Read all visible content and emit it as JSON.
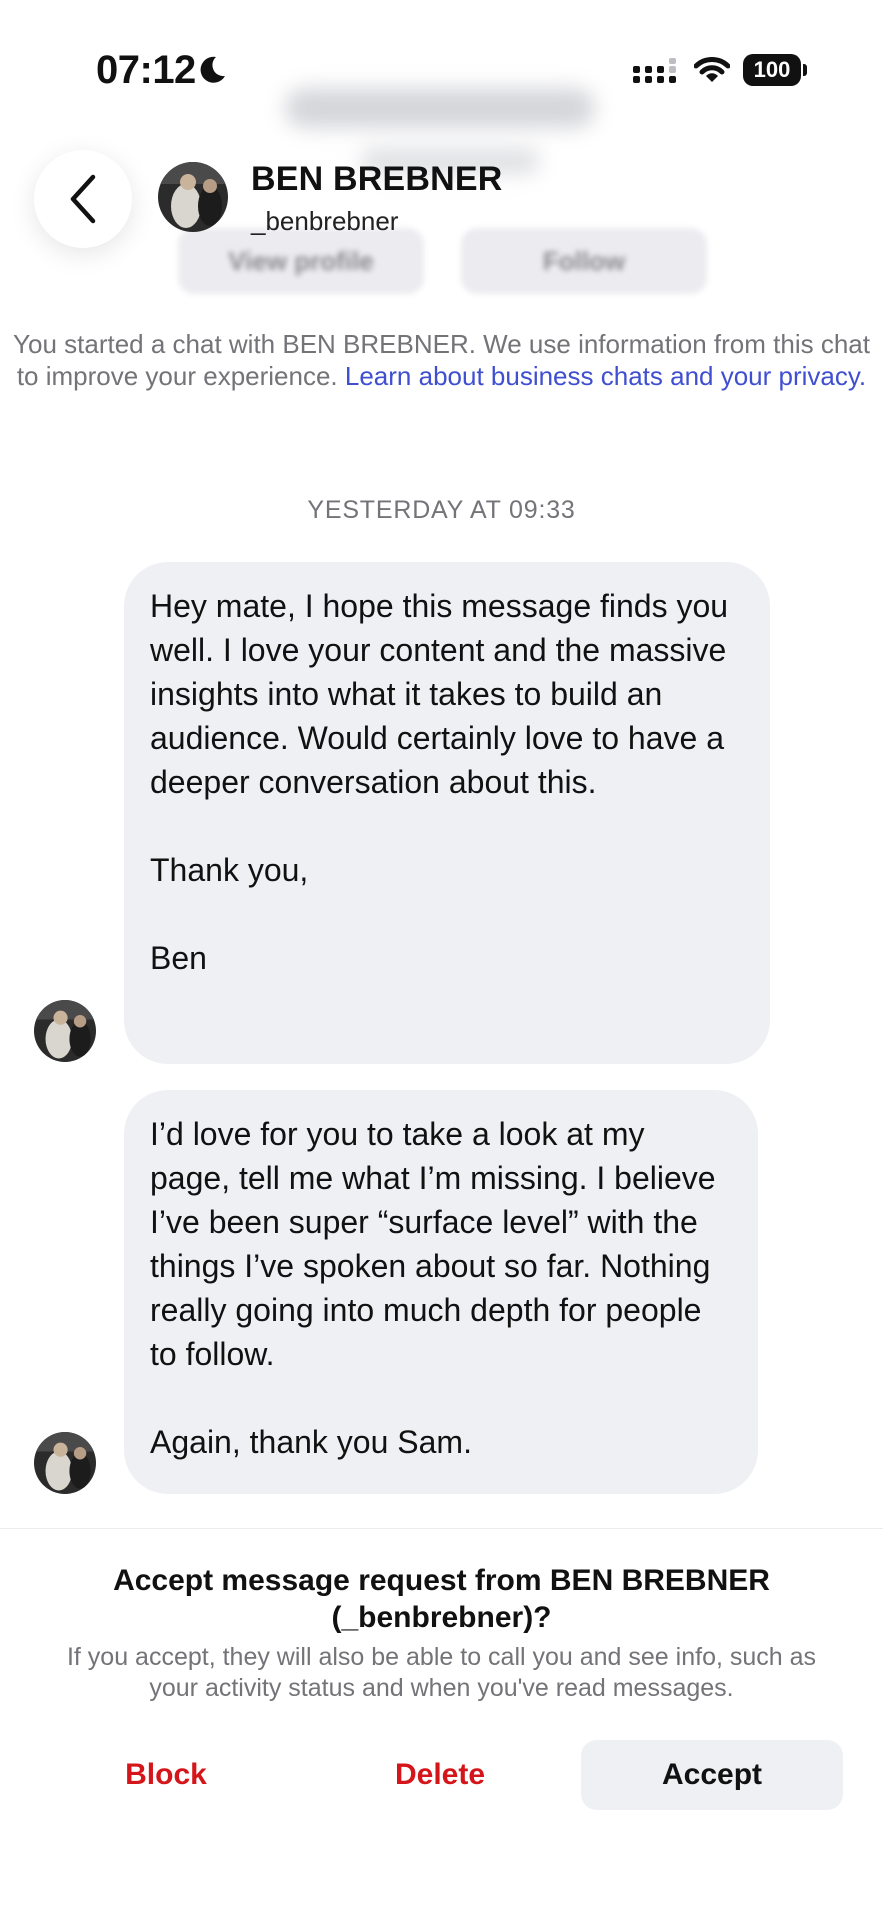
{
  "status_bar": {
    "time": "07:12",
    "battery": "100"
  },
  "background": {
    "view_profile": "View profile",
    "follow": "Follow"
  },
  "header": {
    "name": "BEN BREBNER",
    "handle": "_benbrebner"
  },
  "info": {
    "text": "You started a chat with BEN BREBNER. We use information from this chat to improve your experience.",
    "link": "Learn about business chats and your privacy."
  },
  "thread": {
    "timestamp": "YESTERDAY AT 09:33",
    "messages": [
      {
        "paragraphs": [
          "Hey mate, I hope this message finds you well. I love your content and the massive insights into what it takes to build an audience. Would certainly love to have a deeper conversation about this.",
          "Thank you,",
          "Ben"
        ]
      },
      {
        "paragraphs": [
          "I’d love for you to take a look at my page, tell me what I’m missing. I believe I’ve been super “surface level” with the things I’ve spoken about so far. Nothing really going into much depth for people to follow.",
          "Again, thank you Sam."
        ]
      }
    ]
  },
  "request": {
    "title": "Accept message request from BEN BREBNER (_benbrebner)?",
    "description": "If you accept, they will also be able to call you and see info, such as your activity status and when you've read messages.",
    "block_label": "Block",
    "delete_label": "Delete",
    "accept_label": "Accept"
  },
  "colors": {
    "link": "#3f4fd0",
    "destructive": "#d4161b",
    "bubble": "#eff0f3"
  },
  "icons": [
    "moon-icon",
    "signal-icon",
    "wifi-icon",
    "battery-icon",
    "chevron-left-icon"
  ]
}
